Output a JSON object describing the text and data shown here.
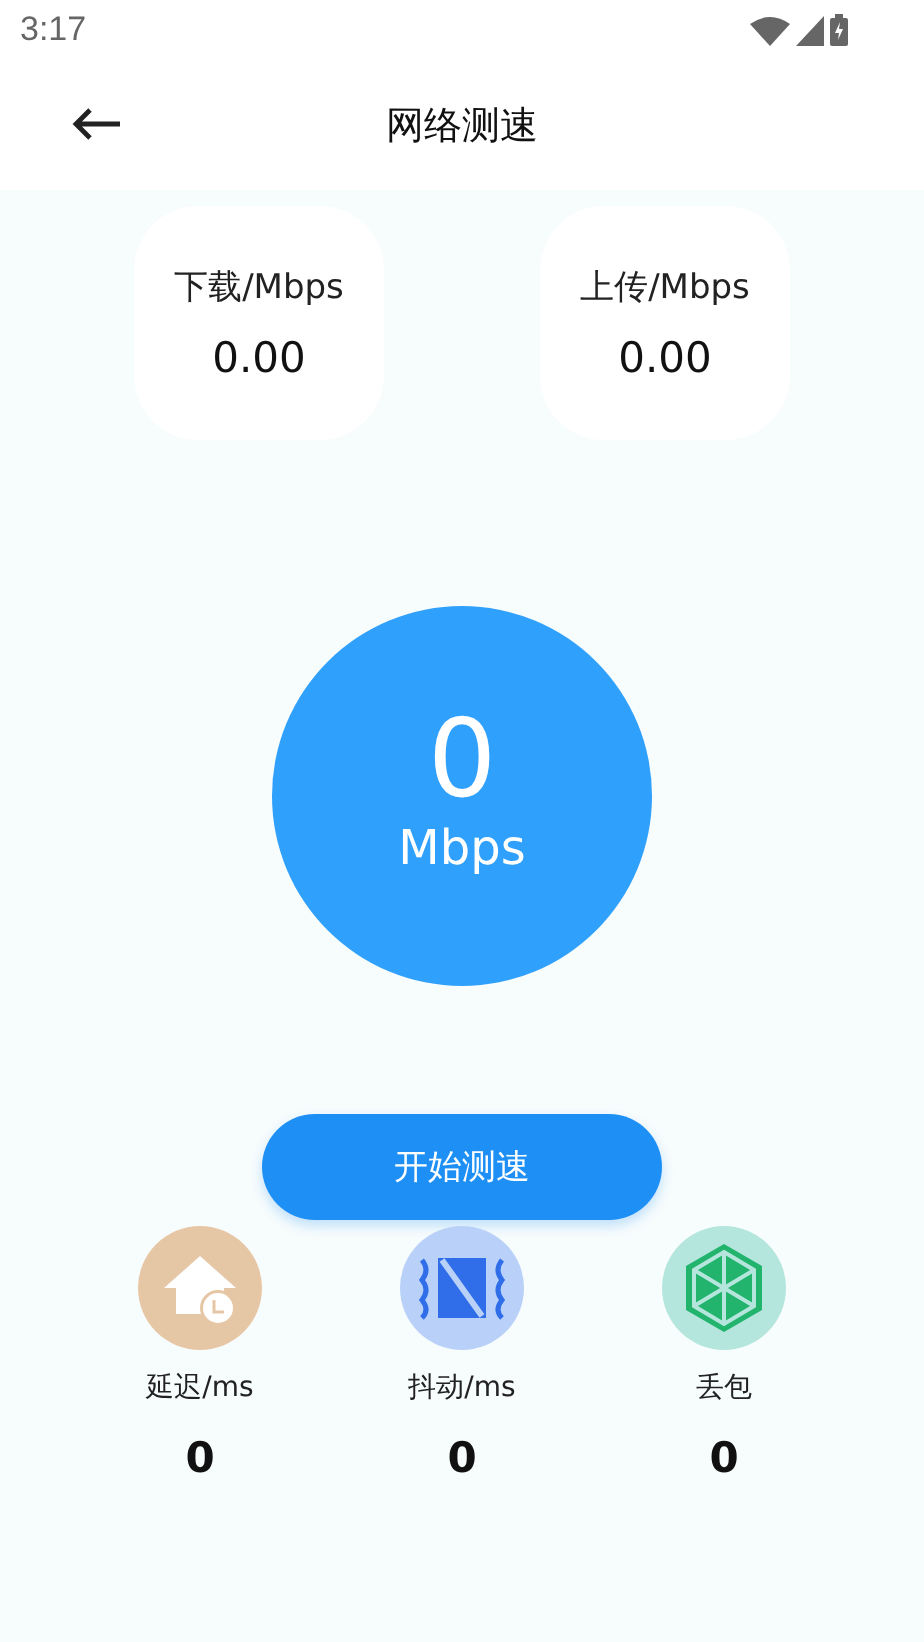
{
  "status_bar": {
    "time": "3:17"
  },
  "header": {
    "title": "网络测速"
  },
  "cards": [
    {
      "label": "下载/Mbps",
      "value": "0.00"
    },
    {
      "label": "上传/Mbps",
      "value": "0.00"
    }
  ],
  "dial": {
    "value": "0",
    "unit": "Mbps"
  },
  "start_button": {
    "label": "开始测速"
  },
  "stats": [
    {
      "kind": "latency",
      "label": "延迟/ms",
      "value": "0"
    },
    {
      "kind": "jitter",
      "label": "抖动/ms",
      "value": "0"
    },
    {
      "kind": "loss",
      "label": "丢包",
      "value": "0"
    }
  ]
}
